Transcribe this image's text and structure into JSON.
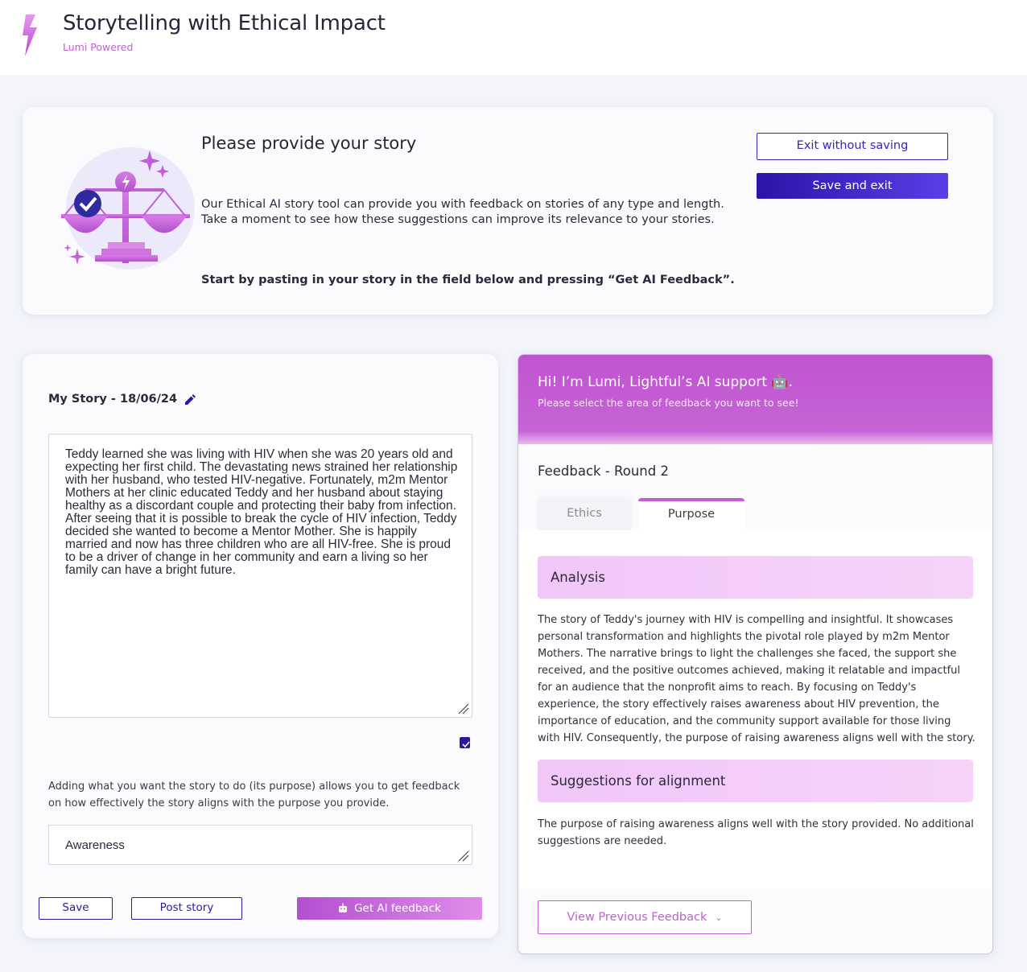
{
  "app": {
    "title": "Storytelling with Ethical Impact",
    "subtitle": "Lumi Powered"
  },
  "intro": {
    "title": "Please provide your story",
    "text": "Our Ethical AI story tool can provide you with feedback on stories of any type and length. Take a moment to see how these suggestions can improve its relevance to your stories.",
    "cta": "Start by pasting in your story in the field below and pressing “Get AI Feedback”.",
    "exit_label": "Exit without saving",
    "save_exit_label": "Save and exit"
  },
  "story": {
    "title": "My Story - 18/06/24",
    "text": "Teddy learned she was living with HIV when she was 20 years old and expecting her first child. The devastating news strained her relationship with her husband, who tested HIV-negative. Fortunately, m2m Mentor Mothers at her clinic educated Teddy and her husband about staying healthy as a discordant couple and protecting their baby from infection. After seeing that it is possible to break the cycle of HIV infection, Teddy decided she wanted to become a Mentor Mother. She is happily married and now has three children who are all HIV-free. She is proud to be a driver of change in her community and earn a living so her family can have a bright future.",
    "purpose_help": "Adding what you want the story to do (its purpose) allows you to get feedback on how effectively the story aligns with the purpose you provide.",
    "purpose_value": "Awareness",
    "save_label": "Save",
    "post_label": "Post story",
    "ai_label": "Get AI feedback"
  },
  "feedback": {
    "greeting": "Hi! I’m Lumi, Lightful’s AI support 🤖.",
    "greeting_sub": "Please select the area of feedback you want to see!",
    "round": "Feedback - Round 2",
    "tabs": [
      {
        "label": "Ethics",
        "active": false
      },
      {
        "label": "Purpose",
        "active": true
      }
    ],
    "analysis_title": "Analysis",
    "analysis_text": "The story of Teddy's journey with HIV is compelling and insightful. It showcases personal transformation and highlights the pivotal role played by m2m Mentor Mothers. The narrative brings to light the challenges she faced, the support she received, and the positive outcomes achieved, making it relatable and impactful for an audience that the nonprofit aims to reach. By focusing on Teddy's experience, the story effectively raises awareness about HIV prevention, the importance of education, and the community support available for those living with HIV. Consequently, the purpose of raising awareness aligns well with the story.",
    "suggestions_title": "Suggestions for alignment",
    "suggestions_text": "The purpose of raising awareness aligns well with the story provided. No additional suggestions are needed.",
    "prev_label": "View Previous Feedback"
  },
  "colors": {
    "brand_purple": "#c05fd0",
    "primary_indigo": "#3a22c0",
    "background": "#f3f5fb"
  },
  "icons": [
    "lightning-logo-icon",
    "scale-icon",
    "pencil-icon",
    "resize-handle-icon",
    "paste-icon",
    "robot-icon",
    "chevron-down-icon"
  ]
}
